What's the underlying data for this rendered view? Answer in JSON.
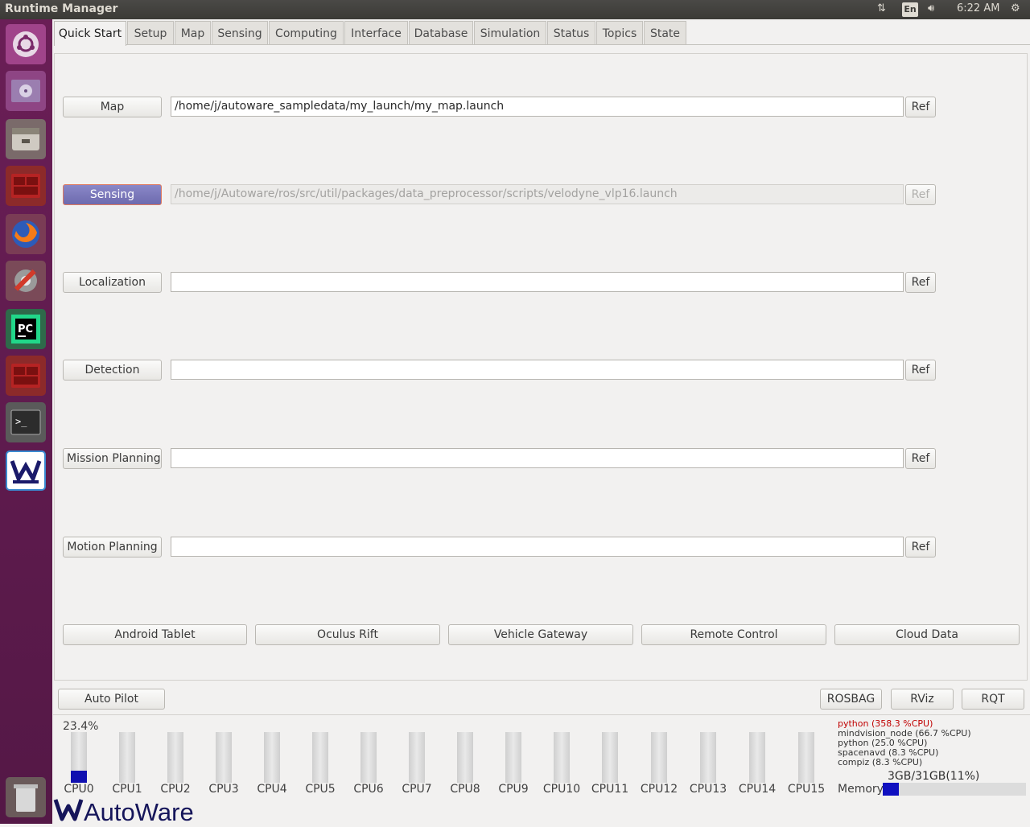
{
  "window": {
    "title": "Runtime Manager"
  },
  "topbar": {
    "keyboard": "En",
    "time": "6:22 AM"
  },
  "tabs": [
    "Quick Start",
    "Setup",
    "Map",
    "Sensing",
    "Computing",
    "Interface",
    "Database",
    "Simulation",
    "Status",
    "Topics",
    "State"
  ],
  "quickstart": {
    "rows": [
      {
        "label": "Map",
        "path": "/home/j/autoware_sampledata/my_launch/my_map.launch",
        "ref": "Ref"
      },
      {
        "label": "Sensing",
        "path": "/home/j/Autoware/ros/src/util/packages/data_preprocessor/scripts/velodyne_vlp16.launch",
        "ref": "Ref"
      },
      {
        "label": "Localization",
        "path": "",
        "ref": "Ref"
      },
      {
        "label": "Detection",
        "path": "",
        "ref": "Ref"
      },
      {
        "label": "Mission Planning",
        "path": "",
        "ref": "Ref"
      },
      {
        "label": "Motion Planning",
        "path": "",
        "ref": "Ref"
      }
    ],
    "devices": [
      "Android Tablet",
      "Oculus Rift",
      "Vehicle Gateway",
      "Remote Control",
      "Cloud Data"
    ]
  },
  "bottom": {
    "autopilot": "Auto Pilot",
    "rosbag": "ROSBAG",
    "rviz": "RViz",
    "rqt": "RQT"
  },
  "cpu": {
    "cpu0_percent": "23.4%",
    "labels": [
      "CPU0",
      "CPU1",
      "CPU2",
      "CPU3",
      "CPU4",
      "CPU5",
      "CPU6",
      "CPU7",
      "CPU8",
      "CPU9",
      "CPU10",
      "CPU11",
      "CPU12",
      "CPU13",
      "CPU14",
      "CPU15"
    ],
    "usage_fraction": [
      0.234,
      0,
      0,
      0,
      0,
      0,
      0,
      0,
      0,
      0,
      0,
      0,
      0,
      0,
      0,
      0
    ]
  },
  "processes": [
    "python (358.3 %CPU)",
    "mindvision_node (66.7 %CPU)",
    "python (25.0 %CPU)",
    "spacenavd (8.3 %CPU)",
    "compiz (8.3 %CPU)"
  ],
  "memory": {
    "label": "Memory",
    "value": "3GB/31GB(11%)",
    "usage_fraction": 0.11
  },
  "logo": {
    "text": "AutoWare"
  },
  "launcher": [
    "ubuntu-dash-icon",
    "dvd-icon",
    "files-icon",
    "terminal-red-icon",
    "firefox-icon",
    "system-settings-icon",
    "pycharm-icon",
    "terminal-red-2-icon",
    "terminal-icon",
    "autoware-icon",
    "trash-icon"
  ]
}
